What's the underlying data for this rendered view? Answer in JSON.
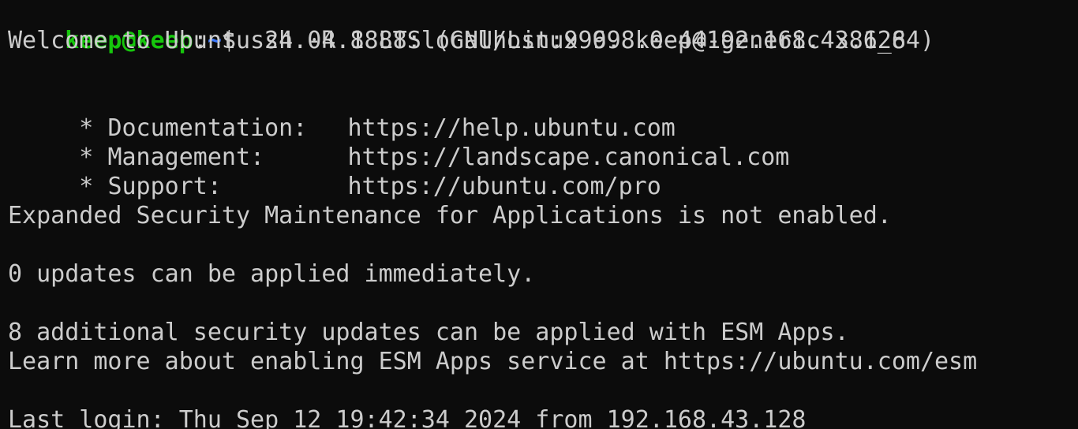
{
  "terminal": {
    "prompt": {
      "user_host": "keep@keep",
      "colon": ":",
      "cwd": "~",
      "symbol": "$ ",
      "command": "ssh -R 8888:localhost:9999 keep@192.168.43.128"
    },
    "welcome": "Welcome to Ubuntu 24.04.1 LTS (GNU/Linux 6.8.0-44-generic x86_64)",
    "links": [
      {
        "bullet": " * ",
        "label": "Documentation:",
        "url": "https://help.ubuntu.com"
      },
      {
        "bullet": " * ",
        "label": "Management:",
        "url": "https://landscape.canonical.com"
      },
      {
        "bullet": " * ",
        "label": "Support:",
        "url": "https://ubuntu.com/pro"
      }
    ],
    "esm_notice": "Expanded Security Maintenance for Applications is not enabled.",
    "updates": "0 updates can be applied immediately.",
    "security_updates": "8 additional security updates can be applied with ESM Apps.",
    "learn_more": "Learn more about enabling ESM Apps service at https://ubuntu.com/esm",
    "last_login": "Last login: Thu Sep 12 19:42:34 2024 from 192.168.43.128"
  },
  "colors": {
    "background": "#0c0c0c",
    "text": "#cccccc",
    "user_host": "#16c60c",
    "cwd": "#3b78ff"
  }
}
